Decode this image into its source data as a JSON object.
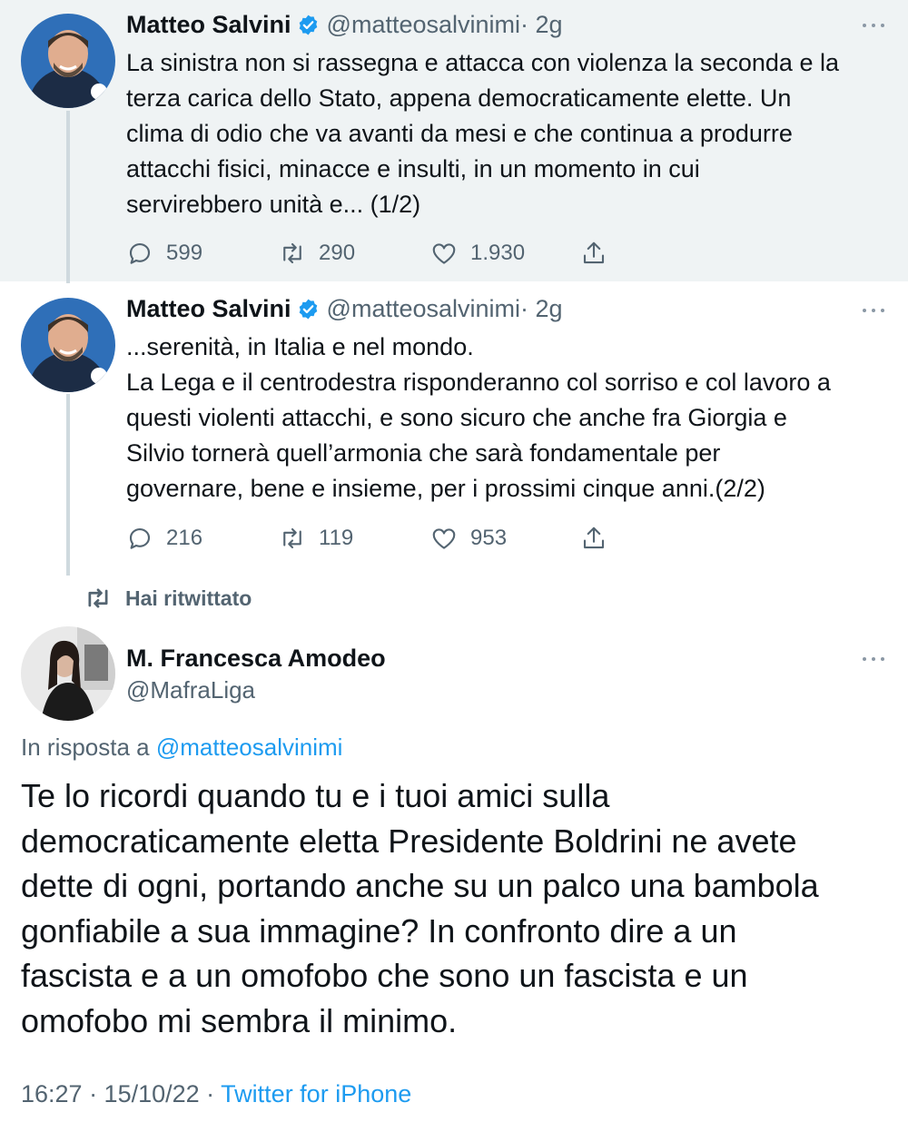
{
  "tweets": [
    {
      "author_name": "Matteo Salvini",
      "verified": true,
      "handle": "@matteosalvinimi",
      "time": "· 2g",
      "lines": [
        "La sinistra non si rassegna e attacca con violenza la seconda e la",
        "terza carica dello Stato, appena democraticamente elette. Un",
        "clima di odio che va avanti da mesi e che continua a produrre",
        "attacchi fisici, minacce e insulti, in un momento in cui",
        "servirebbero unità e... (1/2)"
      ],
      "replies": "599",
      "retweets": "290",
      "likes": "1.930"
    },
    {
      "author_name": "Matteo Salvini",
      "verified": true,
      "handle": "@matteosalvinimi",
      "time": "· 2g",
      "lines": [
        "...serenità, in Italia e nel mondo.",
        "La Lega e il centrodestra risponderanno col sorriso e col lavoro a",
        "questi violenti attacchi, e sono sicuro che anche fra Giorgia e",
        "Silvio tornerà quell’armonia che sarà fondamentale per",
        "governare, bene e insieme, per i prossimi cinque anni.(2/2)"
      ],
      "replies": "216",
      "retweets": "119",
      "likes": "953"
    }
  ],
  "retweet_notice": "Hai ritwittato",
  "reply": {
    "author_name": "M. Francesca Amodeo",
    "handle": "@MafraLiga",
    "reply_prefix": "In risposta a",
    "reply_mention": "@matteosalvinimi",
    "lines": [
      "Te lo ricordi quando tu e i tuoi amici sulla",
      "democraticamente eletta Presidente Boldrini ne avete",
      "dette di ogni, portando anche su un palco una bambola",
      "gonfiabile a sua immagine? In confronto dire a un",
      "fascista e a un omofobo che sono un fascista e un",
      "omofobo mi sembra il minimo."
    ],
    "timestamp": "16:27 · 15/10/22 ·",
    "source": "Twitter for iPhone"
  },
  "icons": {
    "reply": "reply-icon",
    "retweet": "retweet-icon",
    "like": "heart-icon",
    "share": "share-icon",
    "verified": "verified-badge-icon",
    "more": "more-options-icon"
  },
  "colors": {
    "link": "#1d9bf0",
    "secondary_text": "#536471",
    "highlight_bg": "#eff3f4",
    "verified": "#1d9bf0"
  }
}
